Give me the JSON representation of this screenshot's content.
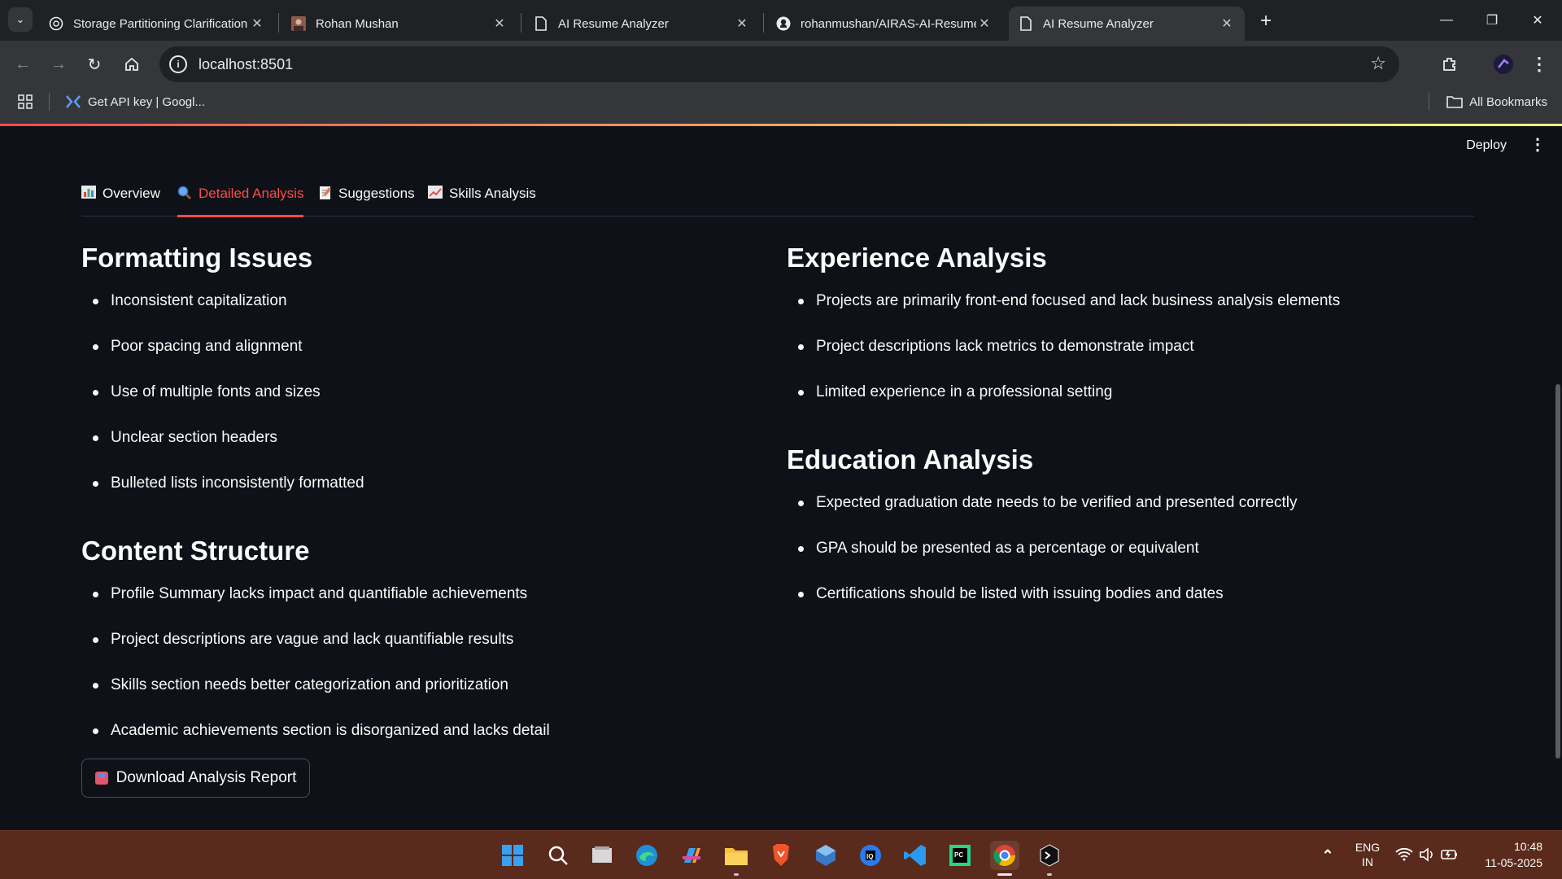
{
  "browser": {
    "tabs": [
      {
        "title": "Storage Partitioning Clarification",
        "icon": "chatgpt-icon"
      },
      {
        "title": "Rohan Mushan",
        "icon": "profile-photo-icon"
      },
      {
        "title": "AI Resume Analyzer",
        "icon": "page-icon"
      },
      {
        "title": "rohanmushan/AIRAS-AI-Resume",
        "icon": "github-icon"
      },
      {
        "title": "AI Resume Analyzer",
        "icon": "page-icon",
        "active": true
      }
    ],
    "url": "localhost:8501",
    "bookmarks": [
      {
        "label": "Get API key | Googl..."
      }
    ],
    "all_bookmarks_label": "All Bookmarks"
  },
  "app": {
    "deploy_label": "Deploy",
    "tabs": [
      {
        "label": "Overview",
        "icon": "bar-chart-icon"
      },
      {
        "label": "Detailed Analysis",
        "icon": "magnifier-icon",
        "active": true
      },
      {
        "label": "Suggestions",
        "icon": "memo-icon"
      },
      {
        "label": "Skills Analysis",
        "icon": "trend-chart-icon"
      }
    ],
    "sections": {
      "formatting": {
        "title": "Formatting Issues",
        "items": [
          "Inconsistent capitalization",
          "Poor spacing and alignment",
          "Use of multiple fonts and sizes",
          "Unclear section headers",
          "Bulleted lists inconsistently formatted"
        ]
      },
      "content": {
        "title": "Content Structure",
        "items": [
          "Profile Summary lacks impact and quantifiable achievements",
          "Project descriptions are vague and lack quantifiable results",
          "Skills section needs better categorization and prioritization",
          "Academic achievements section is disorganized and lacks detail"
        ]
      },
      "experience": {
        "title": "Experience Analysis",
        "items": [
          "Projects are primarily front-end focused and lack business analysis elements",
          "Project descriptions lack metrics to demonstrate impact",
          "Limited experience in a professional setting"
        ]
      },
      "education": {
        "title": "Education Analysis",
        "items": [
          "Expected graduation date needs to be verified and presented correctly",
          "GPA should be presented as a percentage or equivalent",
          "Certifications should be listed with issuing bodies and dates"
        ]
      }
    },
    "download_label": "Download Analysis Report"
  },
  "taskbar": {
    "language": "ENG",
    "region": "IN",
    "time": "10:48",
    "date": "11-05-2025"
  },
  "colors": {
    "accent": "#ff4b4b",
    "background": "#0e1117",
    "text": "#fafafa"
  }
}
